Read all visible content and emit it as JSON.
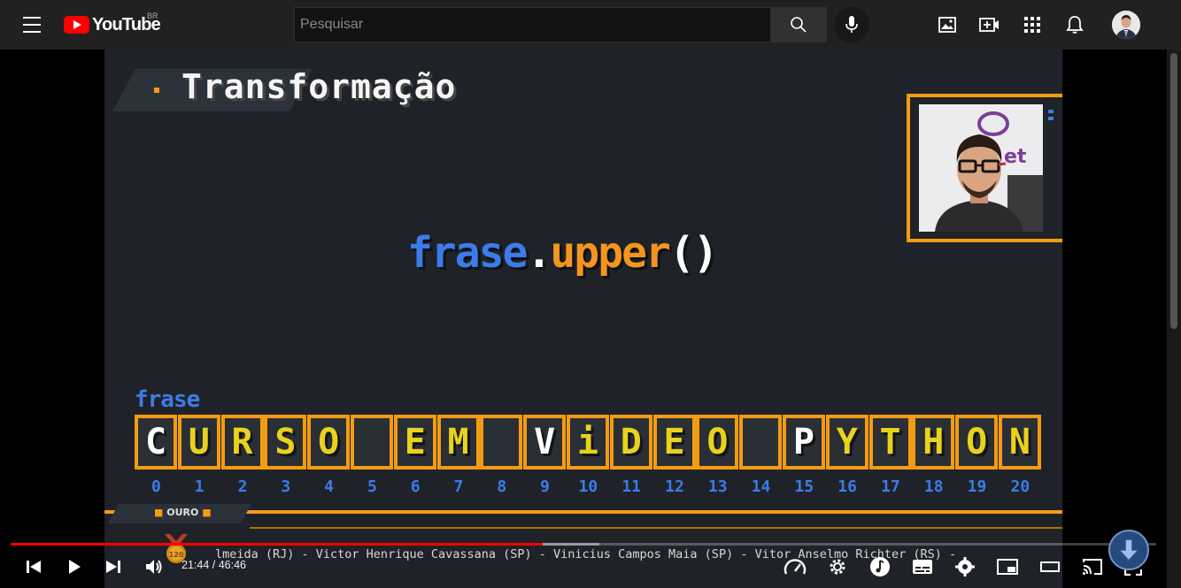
{
  "masthead": {
    "logo_text": "YouTube",
    "country_code": "BR",
    "search": {
      "placeholder": "Pesquisar",
      "value": ""
    },
    "icons": [
      "menu-icon",
      "search-icon",
      "mic-icon",
      "image-icon",
      "create-video-icon",
      "apps-icon",
      "notifications-icon"
    ]
  },
  "video": {
    "title": "Transformação",
    "code": {
      "variable": "frase",
      "dot": ".",
      "method": "upper",
      "parens": "()"
    },
    "variable_label": "frase",
    "cells": [
      "C",
      "U",
      "R",
      "S",
      "O",
      " ",
      "E",
      "M",
      " ",
      "V",
      "i",
      "D",
      "E",
      "O",
      " ",
      "P",
      "Y",
      "T",
      "H",
      "O",
      "N"
    ],
    "white_cells": [
      0,
      9,
      15
    ],
    "indexes": [
      "0",
      "1",
      "2",
      "3",
      "4",
      "5",
      "6",
      "7",
      "8",
      "9",
      "10",
      "11",
      "12",
      "13",
      "14",
      "15",
      "16",
      "17",
      "18",
      "19",
      "20"
    ],
    "badge": {
      "dot_left": "■",
      "label": "OURO",
      "dot_right": "■"
    },
    "medal_value": "120",
    "ticker": "lmeida (RJ) - Victor Henrique Cavassana (SP) - Vinicius Campos Maia (SP) - Vitor Anselmo Richter (RS) -"
  },
  "player": {
    "time_current": "21:44",
    "time_separator": " / ",
    "time_total": "46:46",
    "progress_played_fraction": 0.4648,
    "progress_loaded_fraction": 0.5136,
    "accent_color": "#ff0000"
  },
  "colors": {
    "video_bg": "#1f2329",
    "orange": "#f39c12",
    "blue": "#3d7be8",
    "yellow": "#e8d21f"
  }
}
